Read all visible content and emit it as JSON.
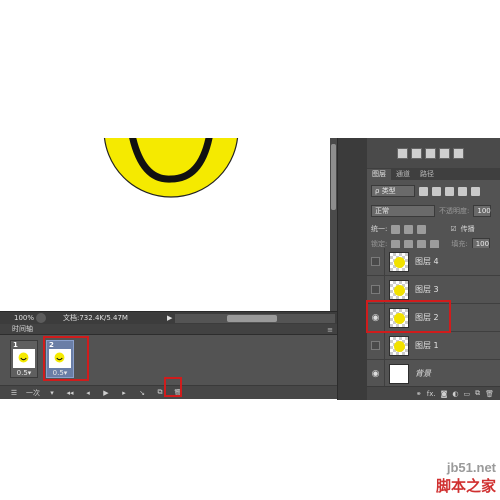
{
  "status_bar": {
    "zoom": "100%",
    "doc_info": "文档:732.4K/5.47M",
    "play_arrow": "▶"
  },
  "timeline": {
    "title": "时间轴",
    "menu_icon": "≡",
    "frames": [
      {
        "number": "1",
        "delay": "0.5▾",
        "selected": false
      },
      {
        "number": "2",
        "delay": "0.5▾",
        "selected": true
      }
    ],
    "loop_option": "一次",
    "controls": [
      "convert-icon",
      "loop-select",
      "first-frame-icon",
      "prev-frame-icon",
      "play-icon",
      "next-frame-icon",
      "tween-icon",
      "duplicate-frame-icon",
      "delete-frame-icon"
    ],
    "control_glyphs": {
      "convert": "☰",
      "dropdown": "▾",
      "first": "◂◂",
      "prev": "◂",
      "play": "▶",
      "next": "▸",
      "tween": "↘",
      "duplicate": "⧉",
      "delete": "🗑"
    }
  },
  "layers_panel": {
    "tabs": [
      "图层",
      "通道",
      "路径"
    ],
    "filter_label": "类型",
    "filter_prefix": "ρ",
    "blend_mode": "正常",
    "opacity_label": "不透明度:",
    "opacity_value": "100",
    "unify_label": "统一:",
    "propagate_label": "传播",
    "lock_label": "锁定:",
    "fill_label": "填充:",
    "fill_value": "100",
    "layers": [
      {
        "name": "图层 4",
        "visible": false,
        "selected": false
      },
      {
        "name": "图层 3",
        "visible": false,
        "selected": false
      },
      {
        "name": "图层 2",
        "visible": true,
        "selected": true
      },
      {
        "name": "图层 1",
        "visible": false,
        "selected": false
      },
      {
        "name": "背景",
        "visible": true,
        "selected": false
      }
    ],
    "bottom_icons": [
      "link-icon",
      "fx-icon",
      "mask-icon",
      "adjustment-icon",
      "folder-icon",
      "new-layer-icon",
      "trash-icon"
    ],
    "bottom_glyphs": [
      "⚭",
      "fx.",
      "◙",
      "◐",
      "▭",
      "⧉",
      "🗑"
    ]
  },
  "watermark": {
    "domain": "jb51.net",
    "name": "脚本之家"
  },
  "colors": {
    "smiley_yellow": "#f5ea00",
    "highlight_red": "#d01c1c",
    "panel_gray": "#535353"
  }
}
